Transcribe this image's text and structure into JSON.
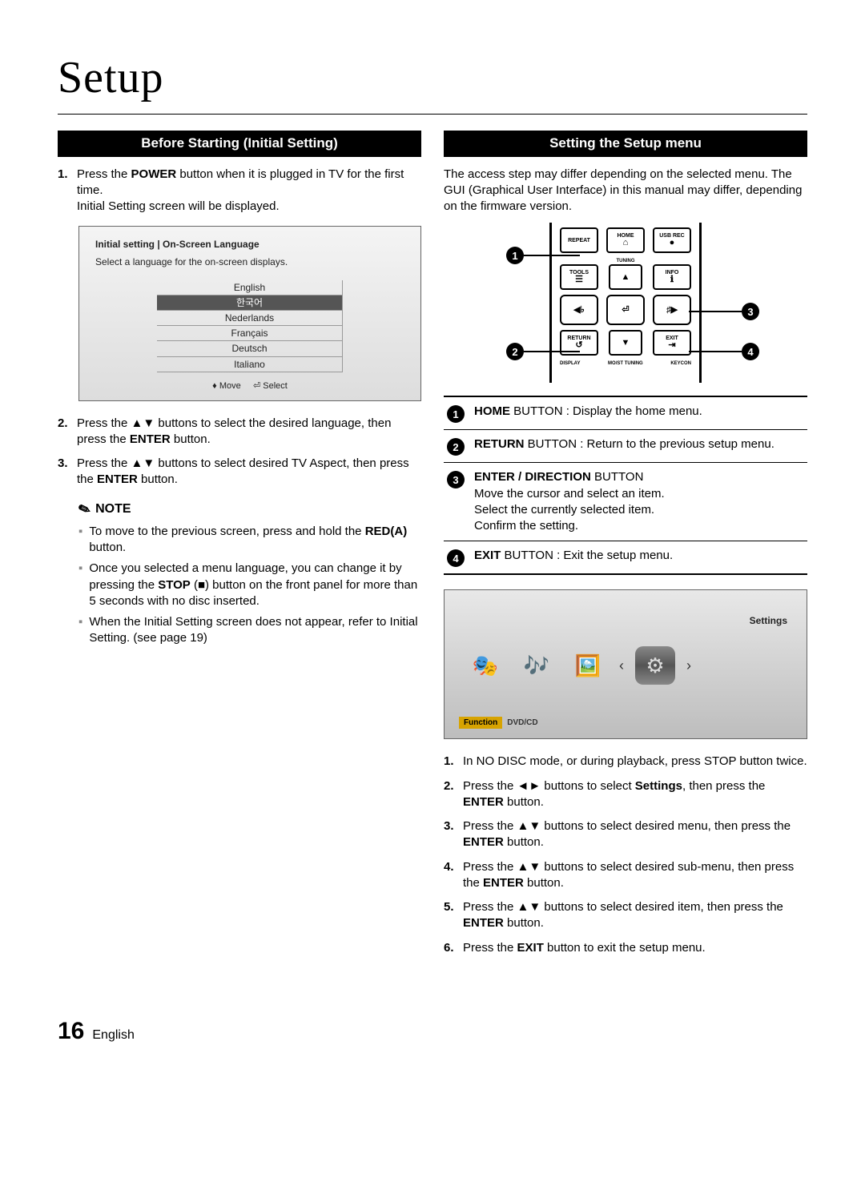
{
  "page_title": "Setup",
  "left": {
    "heading": "Before Starting (Initial Setting)",
    "steps": [
      {
        "num": "1.",
        "text_parts": [
          "Press the ",
          {
            "b": "POWER"
          },
          " button when it is plugged in TV for the first time."
        ],
        "after": "Initial Setting screen will be displayed."
      },
      {
        "num": "2.",
        "text_parts": [
          "Press the ▲▼ buttons to select the desired language, then press the ",
          {
            "b": "ENTER"
          },
          " button."
        ]
      },
      {
        "num": "3.",
        "text_parts": [
          "Press the ▲▼ buttons to select desired TV Aspect, then press the ",
          {
            "b": "ENTER"
          },
          " button."
        ]
      }
    ],
    "init_screen": {
      "hdr1": "Initial setting | On-Screen Language",
      "hdr2": "Select a language for the on-screen displays.",
      "languages": [
        "English",
        "한국어",
        "Nederlands",
        "Français",
        "Deutsch",
        "Italiano"
      ],
      "selected_index": 1,
      "footer_move": "Move",
      "footer_select": "Select"
    },
    "note_label": "NOTE",
    "notes": [
      [
        "To move to the previous screen, press and hold the ",
        {
          "b": "RED(A)"
        },
        " button."
      ],
      [
        "Once you selected a menu language, you can change it by pressing the ",
        {
          "b": "STOP"
        },
        " (■) button on the front panel for more than 5 seconds with no disc inserted."
      ],
      [
        "When the Initial Setting screen does not appear, refer to Initial Setting. (see page 19)"
      ]
    ]
  },
  "right": {
    "heading": "Setting the Setup menu",
    "intro": "The access step may differ depending on the selected menu. The GUI (Graphical User Interface) in this manual may differ, depending on the firmware version.",
    "remote_labels": {
      "repeat": "REPEAT",
      "home": "HOME",
      "usb": "USB REC",
      "tuning": "TUNING",
      "tools": "TOOLS",
      "info": "INFO",
      "return": "RETURN",
      "exit": "EXIT",
      "display": "DISPLAY",
      "mo_st": "MO/ST",
      "tuning2": "TUNING",
      "keycon": "KEYCON"
    },
    "callouts": [
      "1",
      "2",
      "3",
      "4"
    ],
    "button_table": [
      {
        "num": "1",
        "parts": [
          {
            "b": "HOME"
          },
          " BUTTON : Display the home menu."
        ]
      },
      {
        "num": "2",
        "parts": [
          {
            "b": "RETURN"
          },
          " BUTTON : Return to the previous setup menu."
        ]
      },
      {
        "num": "3",
        "parts": [
          {
            "b": "ENTER / DIRECTION"
          },
          " BUTTON",
          {
            "br": true
          },
          "Move the cursor and select an item.",
          {
            "br": true
          },
          "Select the currently selected item.",
          {
            "br": true
          },
          "Confirm the setting."
        ]
      },
      {
        "num": "4",
        "parts": [
          {
            "b": "EXIT"
          },
          " BUTTON : Exit the setup menu."
        ]
      }
    ],
    "settings_shot": {
      "title": "Settings",
      "function_label": "Function",
      "function_value": "DVD/CD"
    },
    "steps2": [
      {
        "num": "1.",
        "parts": [
          "In NO DISC mode, or during playback, press STOP button twice."
        ]
      },
      {
        "num": "2.",
        "parts": [
          "Press the ◄► buttons to select ",
          {
            "b": "Settings"
          },
          ", then press the ",
          {
            "b": "ENTER"
          },
          " button."
        ]
      },
      {
        "num": "3.",
        "parts": [
          "Press the ▲▼ buttons to select desired menu, then press the ",
          {
            "b": "ENTER"
          },
          " button."
        ]
      },
      {
        "num": "4.",
        "parts": [
          "Press the ▲▼ buttons to select desired sub-menu, then press the ",
          {
            "b": "ENTER"
          },
          " button."
        ]
      },
      {
        "num": "5.",
        "parts": [
          "Press the ▲▼ buttons to select desired item, then press the ",
          {
            "b": "ENTER"
          },
          " button."
        ]
      },
      {
        "num": "6.",
        "parts": [
          "Press the ",
          {
            "b": "EXIT"
          },
          " button to exit the setup menu."
        ]
      }
    ]
  },
  "footer": {
    "page": "16",
    "lang": "English"
  }
}
